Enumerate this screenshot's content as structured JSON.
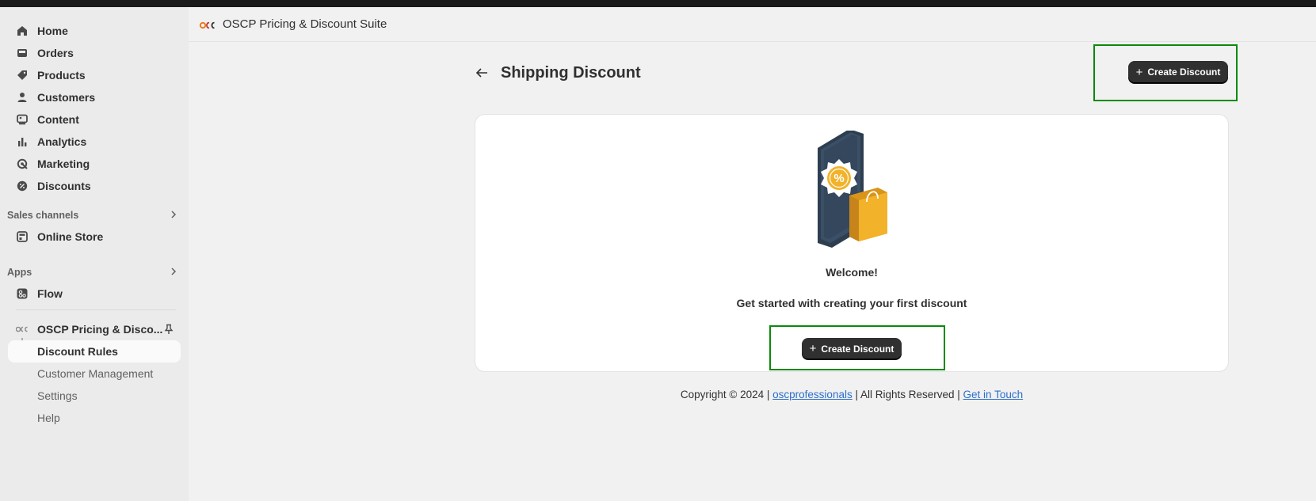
{
  "sidebar": {
    "nav": [
      {
        "label": "Home",
        "icon": "home-icon"
      },
      {
        "label": "Orders",
        "icon": "inbox-icon"
      },
      {
        "label": "Products",
        "icon": "tag-icon"
      },
      {
        "label": "Customers",
        "icon": "person-icon"
      },
      {
        "label": "Content",
        "icon": "image-icon"
      },
      {
        "label": "Analytics",
        "icon": "bar-chart-icon"
      },
      {
        "label": "Marketing",
        "icon": "target-icon"
      },
      {
        "label": "Discounts",
        "icon": "discount-badge-icon"
      }
    ],
    "sales_channels_label": "Sales channels",
    "online_store_label": "Online Store",
    "apps_label": "Apps",
    "flow_label": "Flow",
    "app_name": "OSCP Pricing & Disco...",
    "app_sub": [
      "Discount Rules",
      "Customer Management",
      "Settings",
      "Help"
    ]
  },
  "header": {
    "title": "OSCP Pricing & Discount Suite",
    "logo_text": "OSC"
  },
  "page": {
    "title": "Shipping Discount",
    "create_button": "Create Discount"
  },
  "card": {
    "welcome": "Welcome!",
    "subtitle": "Get started with creating your first discount",
    "create_button": "Create Discount"
  },
  "footer": {
    "prefix": "Copyright © 2024 | ",
    "link1": "oscprofessionals",
    "middle": " | All Rights Reserved | ",
    "link2": "Get in Touch"
  },
  "colors": {
    "accent_dark": "#303030",
    "highlight_green": "#0a8a0a",
    "link": "#2c6ecb",
    "bag": "#f2b22a"
  }
}
